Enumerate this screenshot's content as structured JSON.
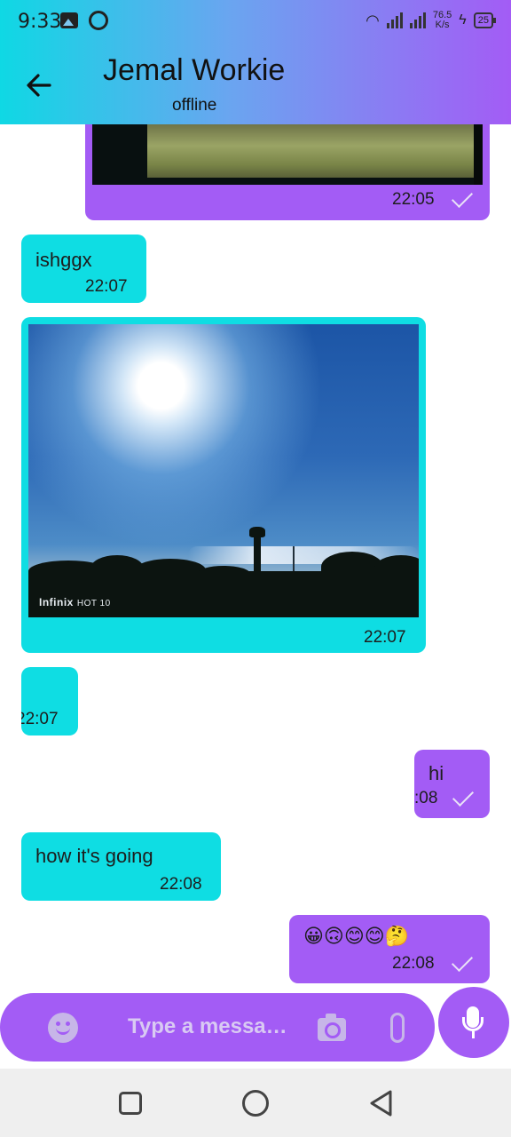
{
  "status_bar": {
    "time": "9:33",
    "net_speed_top": "76.5",
    "net_speed_bottom": "K/s",
    "battery": "25"
  },
  "header": {
    "back_icon": "arrow-left-icon",
    "title": "Jemal Workie",
    "subtitle": "offline"
  },
  "messages": [
    {
      "side": "sent",
      "type": "image",
      "time": "22:05",
      "status": "sent-check"
    },
    {
      "side": "received",
      "type": "text",
      "text": "ishggx",
      "time": "22:07"
    },
    {
      "side": "received",
      "type": "image",
      "time": "22:07",
      "watermark_brand": "Infinix",
      "watermark_model": "HOT 10"
    },
    {
      "side": "received",
      "type": "text",
      "text": "",
      "time": "22:07"
    },
    {
      "side": "sent",
      "type": "text",
      "text": "hi",
      "time": ":08",
      "status": "sent-check"
    },
    {
      "side": "received",
      "type": "text",
      "text": "how it's going",
      "time": "22:08"
    },
    {
      "side": "sent",
      "type": "text",
      "text": "😀🙃😊😊🤔",
      "time": "22:08",
      "status": "sent-check"
    }
  ],
  "composer": {
    "placeholder": "Type a messa…",
    "emoji_icon": "emoji-icon",
    "camera_icon": "camera-icon",
    "attach_icon": "paperclip-icon",
    "mic_icon": "microphone-icon"
  },
  "colors": {
    "sent_bubble": "#a35cf5",
    "received_bubble": "#0fdde3",
    "header_gradient_start": "#0fd8e4",
    "header_gradient_end": "#a35cf5"
  }
}
